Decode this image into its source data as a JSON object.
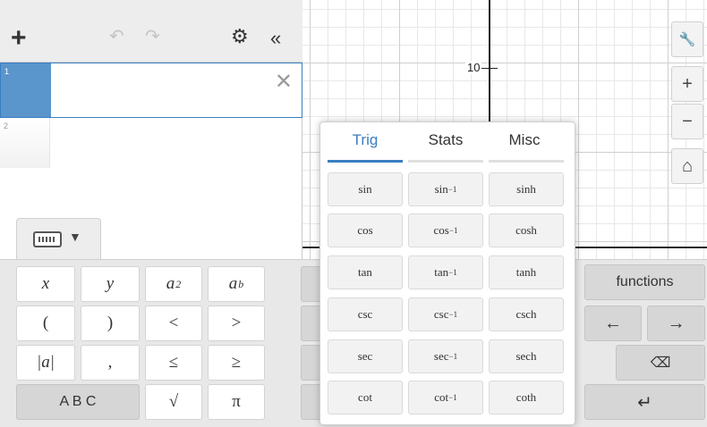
{
  "graph": {
    "axis_label": "10"
  },
  "expressions": {
    "header": {
      "add": "+",
      "undo": "↶",
      "redo": "↷",
      "settings": "⚙",
      "collapse": "«"
    },
    "rows": [
      {
        "num": "1",
        "close": "✕"
      },
      {
        "num": "2"
      }
    ],
    "keyboard_toggle": {
      "caret": "▼"
    }
  },
  "side_buttons": {
    "wrench": "🔧",
    "zoom_in": "+",
    "zoom_out": "−",
    "home": "⌂"
  },
  "keypad": {
    "x": "x",
    "y": "y",
    "a": "a",
    "sq": "2",
    "b": "b",
    "lparen": "(",
    "rparen": ")",
    "lt": "<",
    "gt": ">",
    "abs": "|a|",
    "comma": ",",
    "le": "≤",
    "ge": "≥",
    "abc": "A B C",
    "sqrt": "√",
    "pi": "π",
    "functions": "functions",
    "left": "←",
    "right": "→",
    "backspace": "⌫",
    "enter": "↵"
  },
  "popup": {
    "tabs": [
      "Trig",
      "Stats",
      "Misc"
    ],
    "active_tab": "Trig",
    "functions": [
      [
        "sin",
        "sin",
        "sinh"
      ],
      [
        "cos",
        "cos",
        "cosh"
      ],
      [
        "tan",
        "tan",
        "tanh"
      ],
      [
        "csc",
        "csc",
        "csch"
      ],
      [
        "sec",
        "sec",
        "sech"
      ],
      [
        "cot",
        "cot",
        "coth"
      ]
    ],
    "inverse_sup": "−1"
  }
}
